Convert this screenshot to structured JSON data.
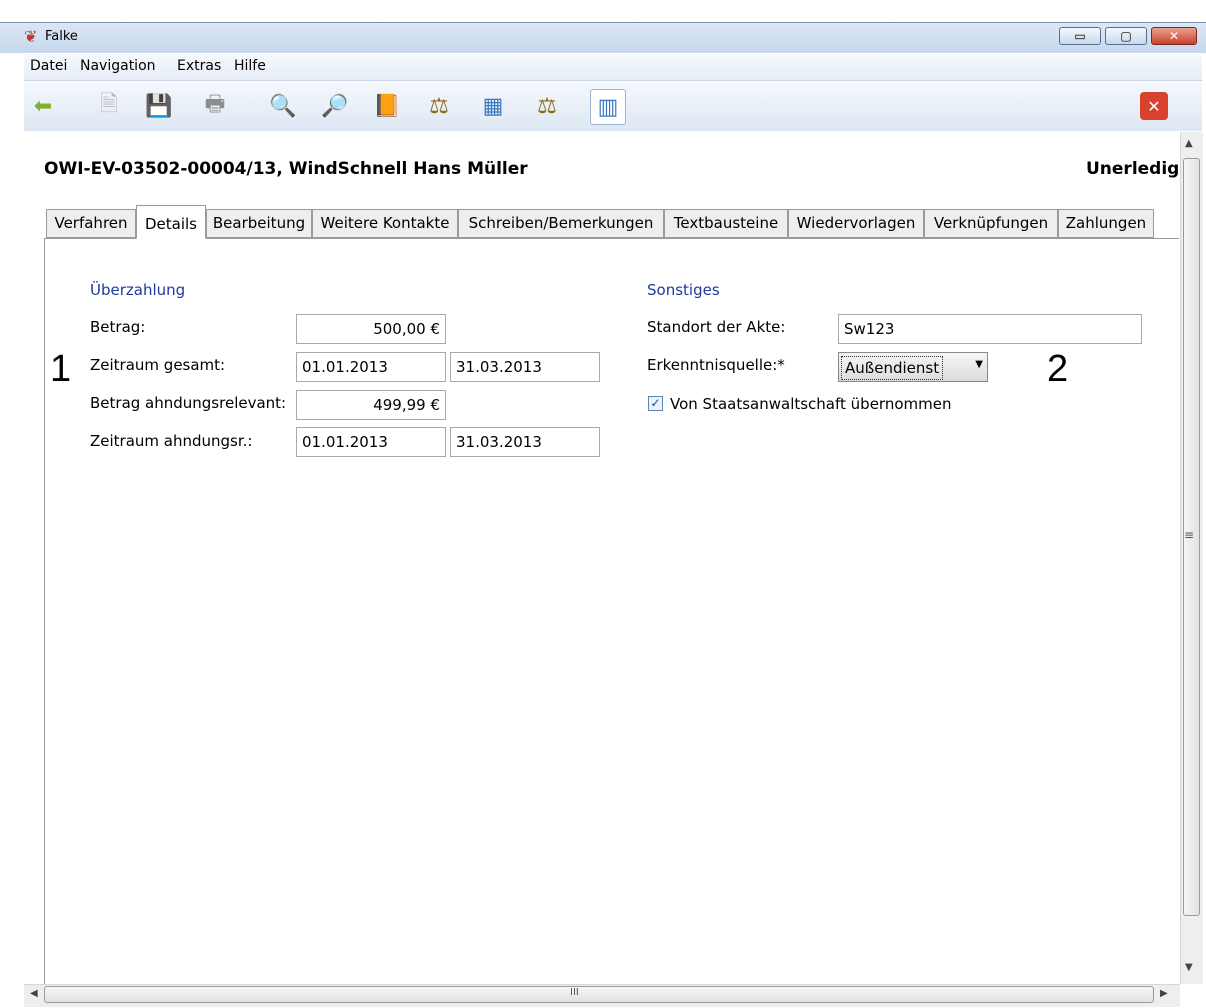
{
  "window": {
    "title": "Falke",
    "minimize": "▭",
    "maximize": "▢",
    "close": "✕"
  },
  "menu": [
    "Datei",
    "Navigation",
    "Extras",
    "Hilfe"
  ],
  "toolbar_icons": [
    "back-arrow-icon",
    "new-document-icon",
    "save-icon",
    "print-icon",
    "search-icon",
    "add-search-icon",
    "book-icon",
    "scales-icon",
    "panel-icon",
    "scales-icon",
    "document-view-icon",
    "close-red-icon"
  ],
  "record": {
    "title": "OWI-EV-03502-00004/13, WindSchnell Hans Müller",
    "status": "Unerledigt"
  },
  "tabs": [
    "Verfahren",
    "Details",
    "Bearbeitung",
    "Weitere Kontakte",
    "Schreiben/Bemerkungen",
    "Textbausteine",
    "Wiedervorlagen",
    "Verknüpfungen",
    "Zahlungen"
  ],
  "active_tab": "Details",
  "ueberzahlung": {
    "heading": "Überzahlung",
    "betrag_label": "Betrag:",
    "betrag": "500,00 €",
    "zeitraum_gesamt_label": "Zeitraum gesamt:",
    "zeitraum_gesamt_von": "01.01.2013",
    "zeitraum_gesamt_bis": "31.03.2013",
    "betrag_relevant_label": "Betrag ahndungsrelevant:",
    "betrag_relevant": "499,99 €",
    "zeitraum_ahndung_label": "Zeitraum ahndungsr.:",
    "zeitraum_ahndung_von": "01.01.2013",
    "zeitraum_ahndung_bis": "31.03.2013"
  },
  "sonstiges": {
    "heading": "Sonstiges",
    "standort_label": "Standort der Akte:",
    "standort": "Sw123",
    "quelle_label": "Erkenntnisquelle:*",
    "quelle": "Außendienst",
    "checkbox_label": "Von Staatsanwaltschaft übernommen",
    "checkbox_checked": true
  },
  "annotations": {
    "one": "1",
    "two": "2"
  },
  "scroll": {
    "grip": "≡",
    "h_grip": "III"
  }
}
